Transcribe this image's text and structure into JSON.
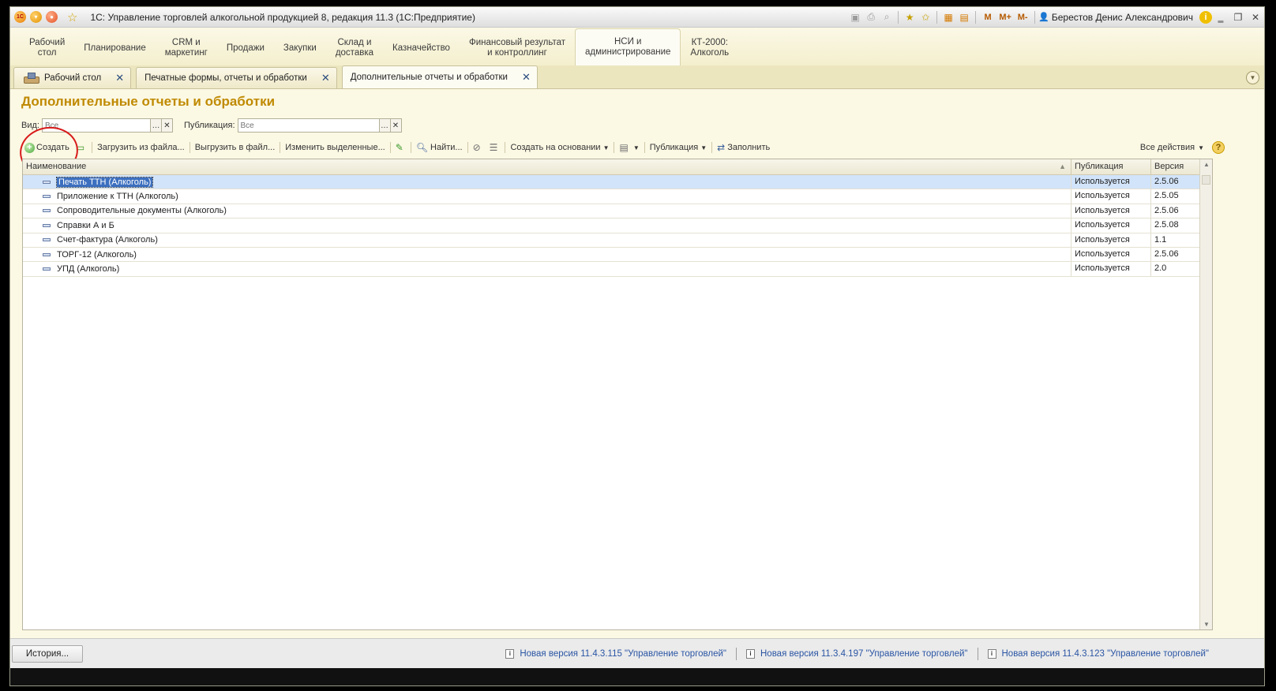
{
  "window": {
    "title": "1С: Управление торговлей алкогольной продукцией 8, редакция 11.3  (1С:Предприятие)",
    "user": "Берестов Денис Александрович",
    "mem_buttons": [
      "M",
      "M+",
      "M-"
    ]
  },
  "sections": [
    {
      "label": "Рабочий\nстол",
      "active": false
    },
    {
      "label": "Планирование",
      "active": false
    },
    {
      "label": "CRM и\nмаркетинг",
      "active": false
    },
    {
      "label": "Продажи",
      "active": false
    },
    {
      "label": "Закупки",
      "active": false
    },
    {
      "label": "Склад и\nдоставка",
      "active": false
    },
    {
      "label": "Казначейство",
      "active": false
    },
    {
      "label": "Финансовый результат\nи контроллинг",
      "active": false
    },
    {
      "label": "НСИ и\nадминистрирование",
      "active": true
    },
    {
      "label": "КТ-2000:\nАлкоголь",
      "active": false
    }
  ],
  "tabs": [
    {
      "label": "Рабочий стол",
      "active": false
    },
    {
      "label": "Печатные формы, отчеты и обработки",
      "active": false
    },
    {
      "label": "Дополнительные отчеты и обработки",
      "active": true
    }
  ],
  "form": {
    "title": "Дополнительные отчеты и обработки",
    "filters": {
      "kind_label": "Вид:",
      "kind_placeholder": "Все",
      "pub_label": "Публикация:",
      "pub_placeholder": "Все"
    },
    "toolbar": {
      "create": "Создать",
      "load_file": "Загрузить из файла...",
      "save_file": "Выгрузить в файл...",
      "edit_selected": "Изменить выделенные...",
      "find": "Найти...",
      "create_based": "Создать на основании",
      "publication": "Публикация",
      "fill": "Заполнить",
      "all_actions": "Все действия"
    },
    "table": {
      "columns": [
        "Наименование",
        "Публикация",
        "Версия"
      ],
      "rows": [
        {
          "name": "Печать ТТН (Алкоголь)",
          "publication": "Используется",
          "version": "2.5.06",
          "selected": true
        },
        {
          "name": "Приложение к ТТН  (Алкоголь)",
          "publication": "Используется",
          "version": "2.5.05",
          "selected": false
        },
        {
          "name": "Сопроводительные документы (Алкоголь)",
          "publication": "Используется",
          "version": "2.5.06",
          "selected": false
        },
        {
          "name": "Справки А и Б",
          "publication": "Используется",
          "version": "2.5.08",
          "selected": false
        },
        {
          "name": "Счет-фактура (Алкоголь)",
          "publication": "Используется",
          "version": "1.1",
          "selected": false
        },
        {
          "name": "ТОРГ-12 (Алкоголь)",
          "publication": "Используется",
          "version": "2.5.06",
          "selected": false
        },
        {
          "name": "УПД (Алкоголь)",
          "publication": "Используется",
          "version": "2.0",
          "selected": false
        }
      ]
    }
  },
  "statusbar": {
    "history": "История...",
    "notices": [
      "Новая версия 11.4.3.115 \"Управление торговлей\"",
      "Новая версия 11.3.4.197 \"Управление торговлей\"",
      "Новая версия 11.4.3.123 \"Управление торговлей\""
    ]
  },
  "colors": {
    "accent_title": "#c08a00",
    "selection": "#3c6fbf",
    "highlight_circle": "#d81a1a"
  }
}
